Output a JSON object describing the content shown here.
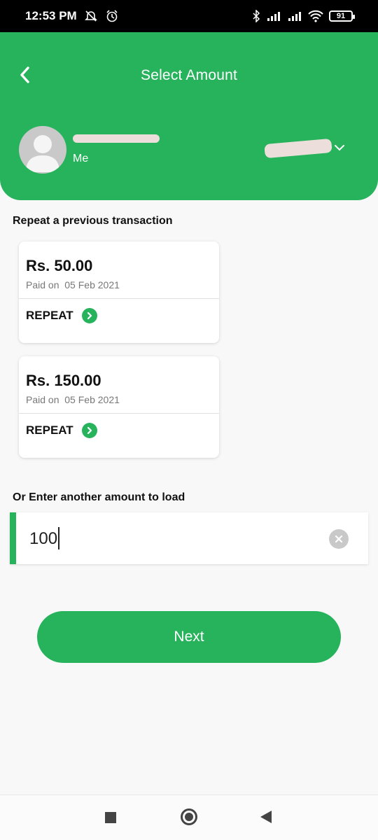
{
  "status_bar": {
    "time": "12:53 PM",
    "battery": "91",
    "icons": [
      "alarm-off-icon",
      "alarm-icon",
      "bluetooth-icon",
      "signal-icon",
      "signal-icon",
      "wifi-icon",
      "battery-icon"
    ]
  },
  "header": {
    "title": "Select Amount",
    "back_icon": "chevron-left-icon",
    "profile_label": "Me",
    "account_dropdown_icon": "chevron-down-icon"
  },
  "previous": {
    "section_label": "Repeat a previous transaction",
    "transactions": [
      {
        "amount": "Rs. 50.00",
        "paid_on_label": "Paid on",
        "date": "05 Feb 2021",
        "action": "REPEAT"
      },
      {
        "amount": "Rs. 150.00",
        "paid_on_label": "Paid on",
        "date": "05 Feb 2021",
        "action": "REPEAT"
      }
    ]
  },
  "custom_amount": {
    "section_label": "Or Enter another amount to load",
    "value": "100",
    "clear_icon": "clear-icon"
  },
  "next_button": {
    "label": "Next"
  },
  "colors": {
    "brand_green": "#27b35c",
    "background": "#f8f8f8",
    "status_bar": "#000000"
  }
}
